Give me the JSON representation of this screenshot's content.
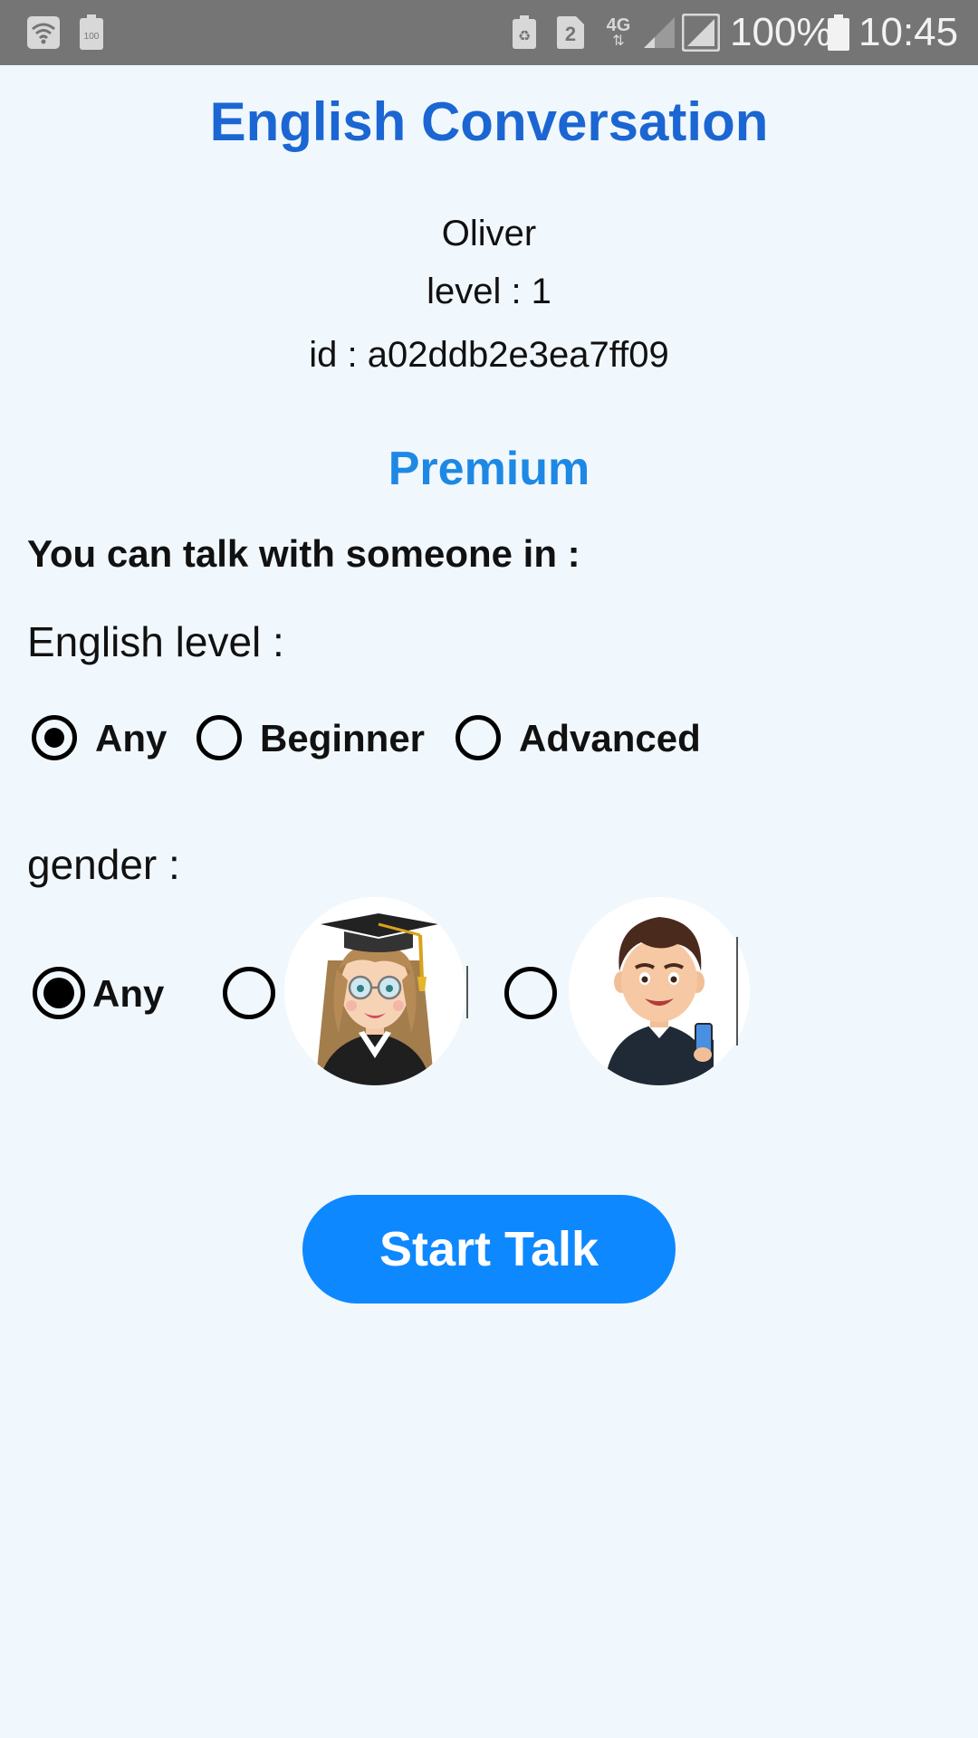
{
  "status_bar": {
    "sim_number": "2",
    "network": "4G",
    "battery_small": "100",
    "battery": "100%",
    "time": "10:45",
    "icons": [
      "wifi-icon",
      "battery-100-icon",
      "recycle-icon",
      "sim-2-icon",
      "network-4g-icon",
      "signal-weak-icon",
      "signal-full-icon",
      "battery-icon"
    ]
  },
  "app": {
    "title": "English Conversation"
  },
  "user": {
    "name": "Oliver",
    "level": "level : 1",
    "id": "id : a02ddb2e3ea7ff09"
  },
  "premium_label": "Premium",
  "talk_heading": "You can talk with someone in :",
  "english_level": {
    "label": "English level :",
    "options": [
      "Any",
      "Beginner",
      "Advanced"
    ],
    "selected": "Any"
  },
  "gender": {
    "label": "gender :",
    "any_label": "Any",
    "options": [
      "Any",
      "female-avatar",
      "male-avatar"
    ],
    "selected": "Any"
  },
  "start_button": "Start Talk",
  "colors": {
    "background": "#f1f8fd",
    "title": "#1b66d2",
    "premium": "#1e88e5",
    "button": "#0e88ff",
    "status_bar": "#757575"
  }
}
